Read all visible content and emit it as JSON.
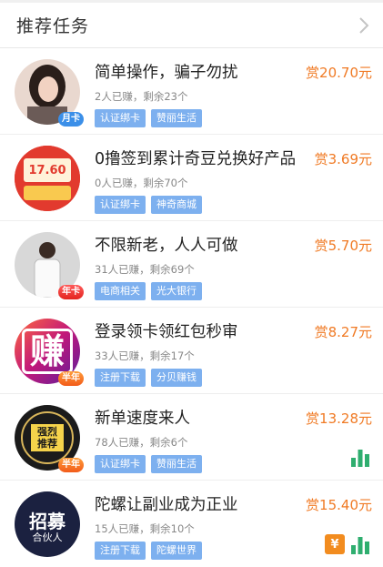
{
  "header": {
    "title": "推荐任务"
  },
  "items": [
    {
      "title": "简单操作，骗子勿扰",
      "reward": "赏20.70元",
      "meta": "2人已赚，剩余23个",
      "tags": [
        "认证绑卡",
        "赞丽生活"
      ],
      "badge": "月卡",
      "avatar": "woman-photo"
    },
    {
      "title": "0撸签到累计奇豆兑换好产品",
      "reward": "赏3.69元",
      "meta": "0人已赚，剩余70个",
      "tags": [
        "认证绑卡",
        "神奇商城"
      ],
      "badge": "",
      "avatar": "red-envelope",
      "avatar_text": "17.60"
    },
    {
      "title": "不限新老，人人可做",
      "reward": "赏5.70元",
      "meta": "31人已赚，剩余69个",
      "tags": [
        "电商相关",
        "光大银行"
      ],
      "badge": "年卡",
      "avatar": "man-photo"
    },
    {
      "title": "登录领卡领红包秒审",
      "reward": "赏8.27元",
      "meta": "33人已赚，剩余17个",
      "tags": [
        "注册下载",
        "分贝赚钱"
      ],
      "badge": "半年",
      "avatar": "zhuan-logo",
      "avatar_text": "赚"
    },
    {
      "title": "新单速度来人",
      "reward": "赏13.28元",
      "meta": "78人已赚，剩余6个",
      "tags": [
        "认证绑卡",
        "赞丽生活"
      ],
      "badge": "半年",
      "avatar": "strongly-recommended",
      "avatar_text": "强烈推荐",
      "right_icons": [
        "bar-chart-icon"
      ]
    },
    {
      "title": "陀螺让副业成为正业",
      "reward": "赏15.40元",
      "meta": "15人已赚，剩余10个",
      "tags": [
        "注册下载",
        "陀螺世界"
      ],
      "badge": "",
      "avatar": "recruit-partner",
      "avatar_text": "招募",
      "avatar_sub": "合伙人",
      "right_icons": [
        "yuan-icon",
        "bar-chart-icon"
      ]
    }
  ],
  "colors": {
    "reward": "#f07a24",
    "tag": "#7db0ef",
    "bar": "#2fae6f",
    "yuan": "#f28c1f"
  }
}
